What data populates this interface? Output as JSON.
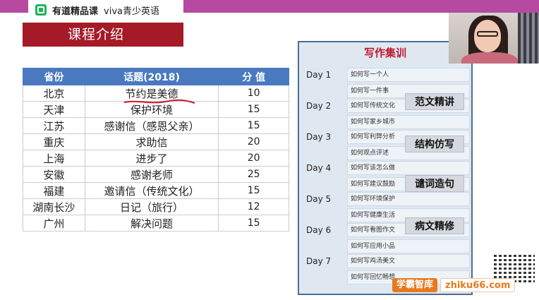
{
  "header": {
    "logo_text": "有道精品课",
    "brand_text": "viva青少英语"
  },
  "section": {
    "title": "课程介绍"
  },
  "table": {
    "headers": [
      "省份",
      "话题(2018)",
      "分  值"
    ],
    "rows": [
      {
        "province": "北京",
        "topic": "节约是美德",
        "score": "10"
      },
      {
        "province": "天津",
        "topic": "保护环境",
        "score": "15"
      },
      {
        "province": "江苏",
        "topic": "感谢信（感恩父亲）",
        "score": "15"
      },
      {
        "province": "重庆",
        "topic": "求助信",
        "score": "20"
      },
      {
        "province": "上海",
        "topic": "进步了",
        "score": "20"
      },
      {
        "province": "安徽",
        "topic": "感谢老师",
        "score": "25"
      },
      {
        "province": "福建",
        "topic": "邀请信（传统文化）",
        "score": "15"
      },
      {
        "province": "湖南长沙",
        "topic": "日记（旅行）",
        "score": "12"
      },
      {
        "province": "广州",
        "topic": "解决问题",
        "score": "15"
      }
    ]
  },
  "writing": {
    "title": "写作集训",
    "days": [
      {
        "label": "Day 1",
        "items": [
          "如何写一个人",
          "如何写一件事"
        ]
      },
      {
        "label": "Day 2",
        "items": [
          "如何写传统文化",
          "如何写家乡城市"
        ]
      },
      {
        "label": "Day 3",
        "items": [
          "如何写利弊分析",
          "如何观点评述"
        ]
      },
      {
        "label": "Day 4",
        "items": [
          "如何写该怎么做",
          "如何写建议鼓励"
        ]
      },
      {
        "label": "Day 5",
        "items": [
          "如何写环境保护",
          "如何写健康生活"
        ]
      },
      {
        "label": "Day 6",
        "items": [
          "如何写看图作文",
          "如何写应用小品"
        ]
      },
      {
        "label": "Day 7",
        "items": [
          "如何写鸡汤美文",
          "如何写回忆畅想"
        ]
      }
    ],
    "tags": [
      "范文精讲",
      "结构仿写",
      "谴词造句",
      "病文精修"
    ]
  },
  "watermark": {
    "cn": "学霸智库",
    "url": "zhiku66.com"
  },
  "colors": {
    "accent_red": "#a51a27",
    "table_header": "#4a79c0",
    "top_strip": "#b54aa0",
    "panel_border": "#4a6e9a"
  }
}
